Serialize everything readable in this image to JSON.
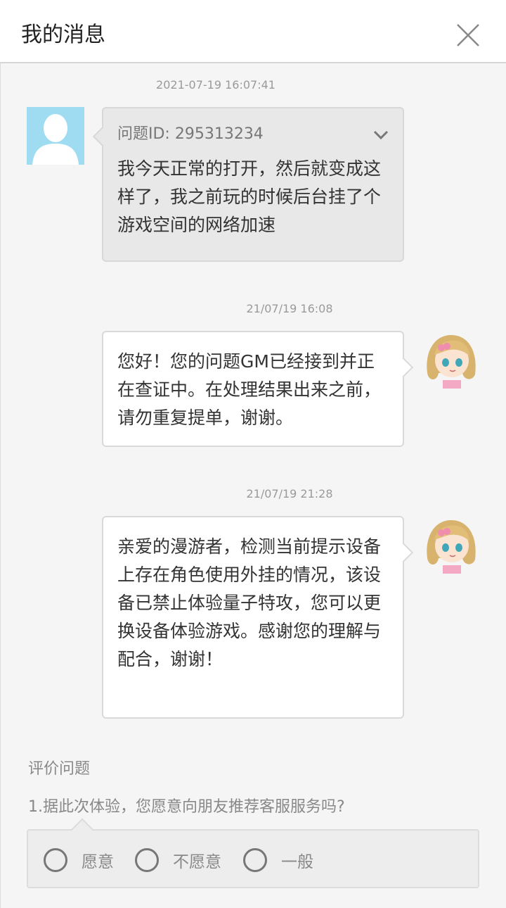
{
  "header": {
    "title": "我的消息"
  },
  "messages": [
    {
      "timestamp": "2021-07-19 16:07:41",
      "question_id": "问题ID: 295313234",
      "text": "我今天正常的打开，然后就变成这样了，我之前玩的时候后台挂了个游戏空间的网络加速"
    },
    {
      "timestamp": "21/07/19 16:08",
      "text": "您好！您的问题GM已经接到并正在查证中。在处理结果出来之前，请勿重复提单，谢谢。"
    },
    {
      "timestamp": "21/07/19 21:28",
      "text": "亲爱的漫游者，检测当前提示设备上存在角色使用外挂的情况，该设备已禁止体验量子特攻，您可以更换设备体验游戏。感谢您的理解与配合，谢谢！"
    }
  ],
  "rating": {
    "title": "评价问题",
    "question": "1.据此次体验，您愿意向朋友推荐客服服务吗?",
    "options": [
      "愿意",
      "不愿意",
      "一般"
    ]
  },
  "colors": {
    "user_avatar_bg": "#9fdcf2",
    "bubble_gray": "#e8e8e8",
    "bubble_white": "#ffffff"
  }
}
